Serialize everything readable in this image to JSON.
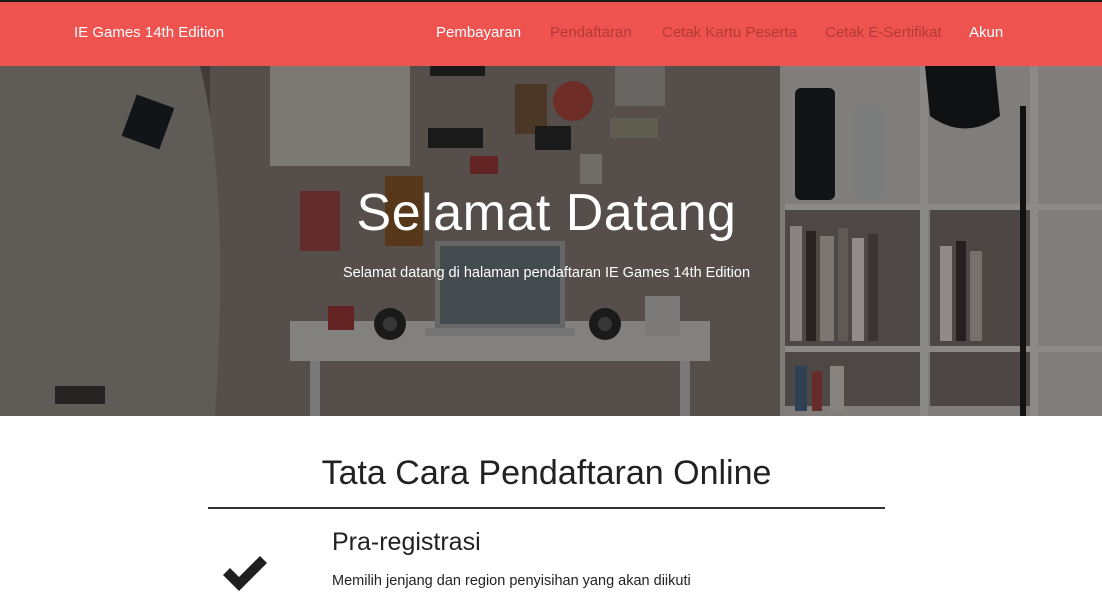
{
  "navbar": {
    "brand": "IE Games 14th Edition",
    "items": [
      {
        "label": "Pembayaran",
        "state": "active"
      },
      {
        "label": "Pendaftaran",
        "state": "muted"
      },
      {
        "label": "Cetak Kartu Peserta",
        "state": "muted"
      },
      {
        "label": "Cetak E-Sertifikat",
        "state": "muted"
      },
      {
        "label": "Akun",
        "state": "normal"
      }
    ],
    "colors": {
      "background": "#ee5350",
      "muted_text": "#b33a38",
      "text": "#ffffff"
    }
  },
  "hero": {
    "title": "Selamat Datang",
    "subtitle": "Selamat datang di halaman pendaftaran IE Games 14th Edition"
  },
  "section": {
    "title": "Tata Cara Pendaftaran Online",
    "steps": [
      {
        "icon": "check-icon",
        "title": "Pra-registrasi",
        "description": "Memilih jenjang dan region penyisihan yang akan diikuti"
      }
    ]
  }
}
